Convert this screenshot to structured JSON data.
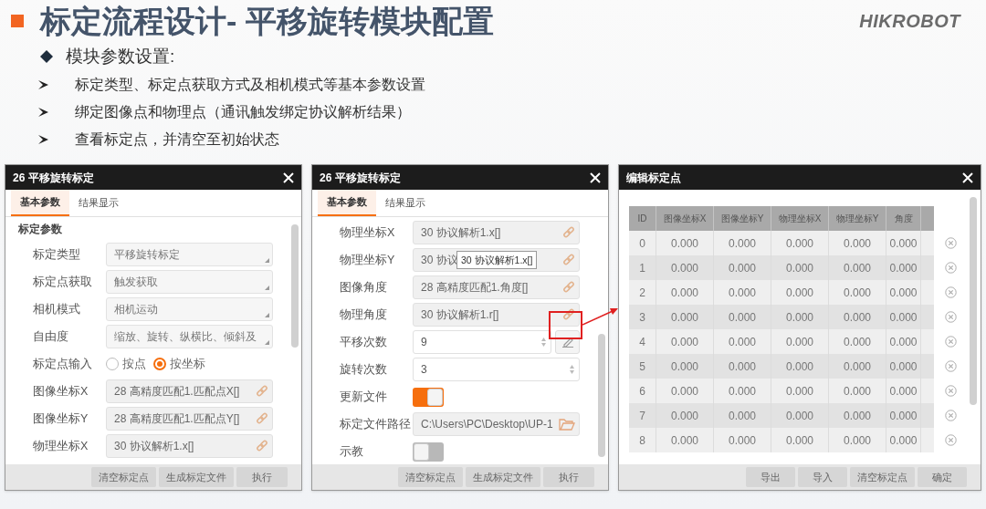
{
  "slide": {
    "title": "标定流程设计- 平移旋转模块配置",
    "logo": "HIKROBOT",
    "heading": "模块参数设置:",
    "bullets": [
      "标定类型、标定点获取方式及相机模式等基本参数设置",
      "绑定图像点和物理点（通讯触发绑定协议解析结果）",
      "查看标定点，并清空至初始状态"
    ]
  },
  "dialogs": [
    {
      "title": "26 平移旋转标定",
      "tabs": [
        {
          "label": "基本参数",
          "selected": true
        },
        {
          "label": "结果显示",
          "selected": false
        }
      ],
      "section": "标定参数",
      "rows": [
        {
          "kind": "dropdown",
          "label": "标定类型",
          "value": "平移旋转标定"
        },
        {
          "kind": "dropdown",
          "label": "标定点获取",
          "value": "触发获取"
        },
        {
          "kind": "dropdown",
          "label": "相机模式",
          "value": "相机运动"
        },
        {
          "kind": "dropdown",
          "label": "自由度",
          "value": "缩放、旋转、纵横比、倾斜及"
        },
        {
          "kind": "radio",
          "label": "标定点输入",
          "options": [
            {
              "label": "按点",
              "selected": false
            },
            {
              "label": "按坐标",
              "selected": true
            }
          ]
        },
        {
          "kind": "link",
          "label": "图像坐标X",
          "value": "28 高精度匹配1.匹配点X[]"
        },
        {
          "kind": "link",
          "label": "图像坐标Y",
          "value": "28 高精度匹配1.匹配点Y[]"
        },
        {
          "kind": "link",
          "label": "物理坐标X",
          "value": "30 协议解析1.x[]"
        }
      ],
      "buttons": [
        "清空标定点",
        "生成标定文件",
        "执行"
      ]
    },
    {
      "title": "26 平移旋转标定",
      "tabs": [
        {
          "label": "基本参数",
          "selected": true
        },
        {
          "label": "结果显示",
          "selected": false
        }
      ],
      "rows": [
        {
          "kind": "link",
          "label": "物理坐标X",
          "value": "30 协议解析1.x[]"
        },
        {
          "kind": "link",
          "label": "物理坐标Y",
          "value": "30 协议",
          "tooltip": "30 协议解析1.x[]"
        },
        {
          "kind": "link",
          "label": "图像角度",
          "value": "28 高精度匹配1.角度[]"
        },
        {
          "kind": "link",
          "label": "物理角度",
          "value": "30 协议解析1.r[]"
        },
        {
          "kind": "spin",
          "label": "平移次数",
          "value": "9",
          "edit": true
        },
        {
          "kind": "spin",
          "label": "旋转次数",
          "value": "3"
        },
        {
          "kind": "toggle",
          "label": "更新文件",
          "on": true
        },
        {
          "kind": "path",
          "label": "标定文件路径",
          "value": "C:\\Users\\PC\\Desktop\\UP-1"
        },
        {
          "kind": "toggle",
          "label": "示教",
          "on": false
        }
      ],
      "buttons": [
        "清空标定点",
        "生成标定文件",
        "执行"
      ]
    }
  ],
  "editor": {
    "title": "编辑标定点",
    "columns": [
      "ID",
      "图像坐标X",
      "图像坐标Y",
      "物理坐标X",
      "物理坐标Y",
      "角度"
    ],
    "rows": [
      [
        "0",
        "0.000",
        "0.000",
        "0.000",
        "0.000",
        "0.000"
      ],
      [
        "1",
        "0.000",
        "0.000",
        "0.000",
        "0.000",
        "0.000"
      ],
      [
        "2",
        "0.000",
        "0.000",
        "0.000",
        "0.000",
        "0.000"
      ],
      [
        "3",
        "0.000",
        "0.000",
        "0.000",
        "0.000",
        "0.000"
      ],
      [
        "4",
        "0.000",
        "0.000",
        "0.000",
        "0.000",
        "0.000"
      ],
      [
        "5",
        "0.000",
        "0.000",
        "0.000",
        "0.000",
        "0.000"
      ],
      [
        "6",
        "0.000",
        "0.000",
        "0.000",
        "0.000",
        "0.000"
      ],
      [
        "7",
        "0.000",
        "0.000",
        "0.000",
        "0.000",
        "0.000"
      ],
      [
        "8",
        "0.000",
        "0.000",
        "0.000",
        "0.000",
        "0.000"
      ]
    ],
    "buttons": [
      "导出",
      "导入",
      "清空标定点",
      "确定"
    ]
  }
}
